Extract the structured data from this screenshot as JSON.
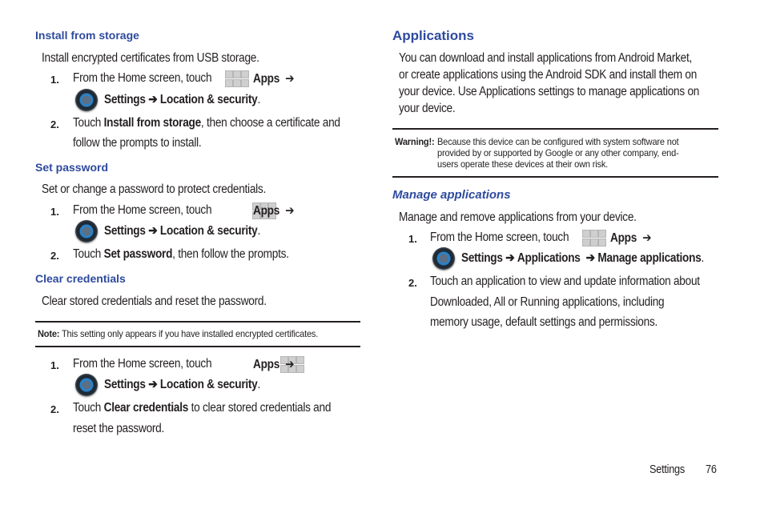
{
  "left": {
    "install_from_storage": {
      "heading": "Install from storage",
      "desc": "Install encrypted certificates from USB storage.",
      "step1_num": "1.",
      "step1_text": "From the Home screen, touch",
      "apps_label": "Apps",
      "arrow": "➔",
      "settings_label": "Settings",
      "path_tail": "Location & security",
      "period": ".",
      "step2_num": "2.",
      "step2_pre": "Touch",
      "step2_bold": "Install from storage",
      "step2_post": ", then choose a certificate and",
      "step2_line2": "follow the prompts to install."
    },
    "set_password": {
      "heading": "Set password",
      "desc": "Set or change a password to protect credentials.",
      "step1_num": "1.",
      "step1_text": "From the Home screen, touch",
      "apps_label": "Apps",
      "arrow": "➔",
      "settings_label": "Settings",
      "path_tail": "Location & security",
      "period": ".",
      "step2_num": "2.",
      "step2_pre": "Touch",
      "step2_bold": "Set password",
      "step2_post": ", then follow the prompts."
    },
    "clear_credentials": {
      "heading": "Clear credentials",
      "desc": "Clear stored credentials and reset the password.",
      "note_label": "Note:",
      "note_text": "This setting only appears if you have installed encrypted certificates.",
      "step1_num": "1.",
      "step1_text": "From the Home screen, touch",
      "apps_label": "Apps",
      "arrow": "➔",
      "settings_label": "Settings",
      "path_tail": "Location & security",
      "period": ".",
      "step2_num": "2.",
      "step2_pre": "Touch",
      "step2_bold": "Clear credentials",
      "step2_post": "to clear stored credentials and",
      "step2_line2": "reset the password."
    }
  },
  "right": {
    "applications": {
      "heading": "Applications",
      "para_lines": [
        "You can download and install applications from Android Market,",
        "or create applications using the Android SDK and install them on",
        "your device. Use Applications settings to manage applications on",
        "your device."
      ],
      "warning_label": "Warning!:",
      "warning_lines": [
        "Because this device can be configured with system software not",
        "provided by or supported by Google or any other company, end-",
        "users operate these devices at their own risk."
      ]
    },
    "manage_applications": {
      "heading": "Manage applications",
      "desc": "Manage and remove applications from your device.",
      "step1_num": "1.",
      "step1_text": "From the Home screen, touch",
      "apps_label": "Apps",
      "arrow": "➔",
      "settings_label": "Settings",
      "path_mid": "Applications",
      "path_tail": "Manage applications",
      "period": ".",
      "step2_num": "2.",
      "step2_lines": [
        "Touch an application to view and update information about",
        "Downloaded, All or Running applications, including",
        "memory usage, default settings and permissions."
      ]
    }
  },
  "footer": {
    "section": "Settings",
    "page_number": "76"
  }
}
